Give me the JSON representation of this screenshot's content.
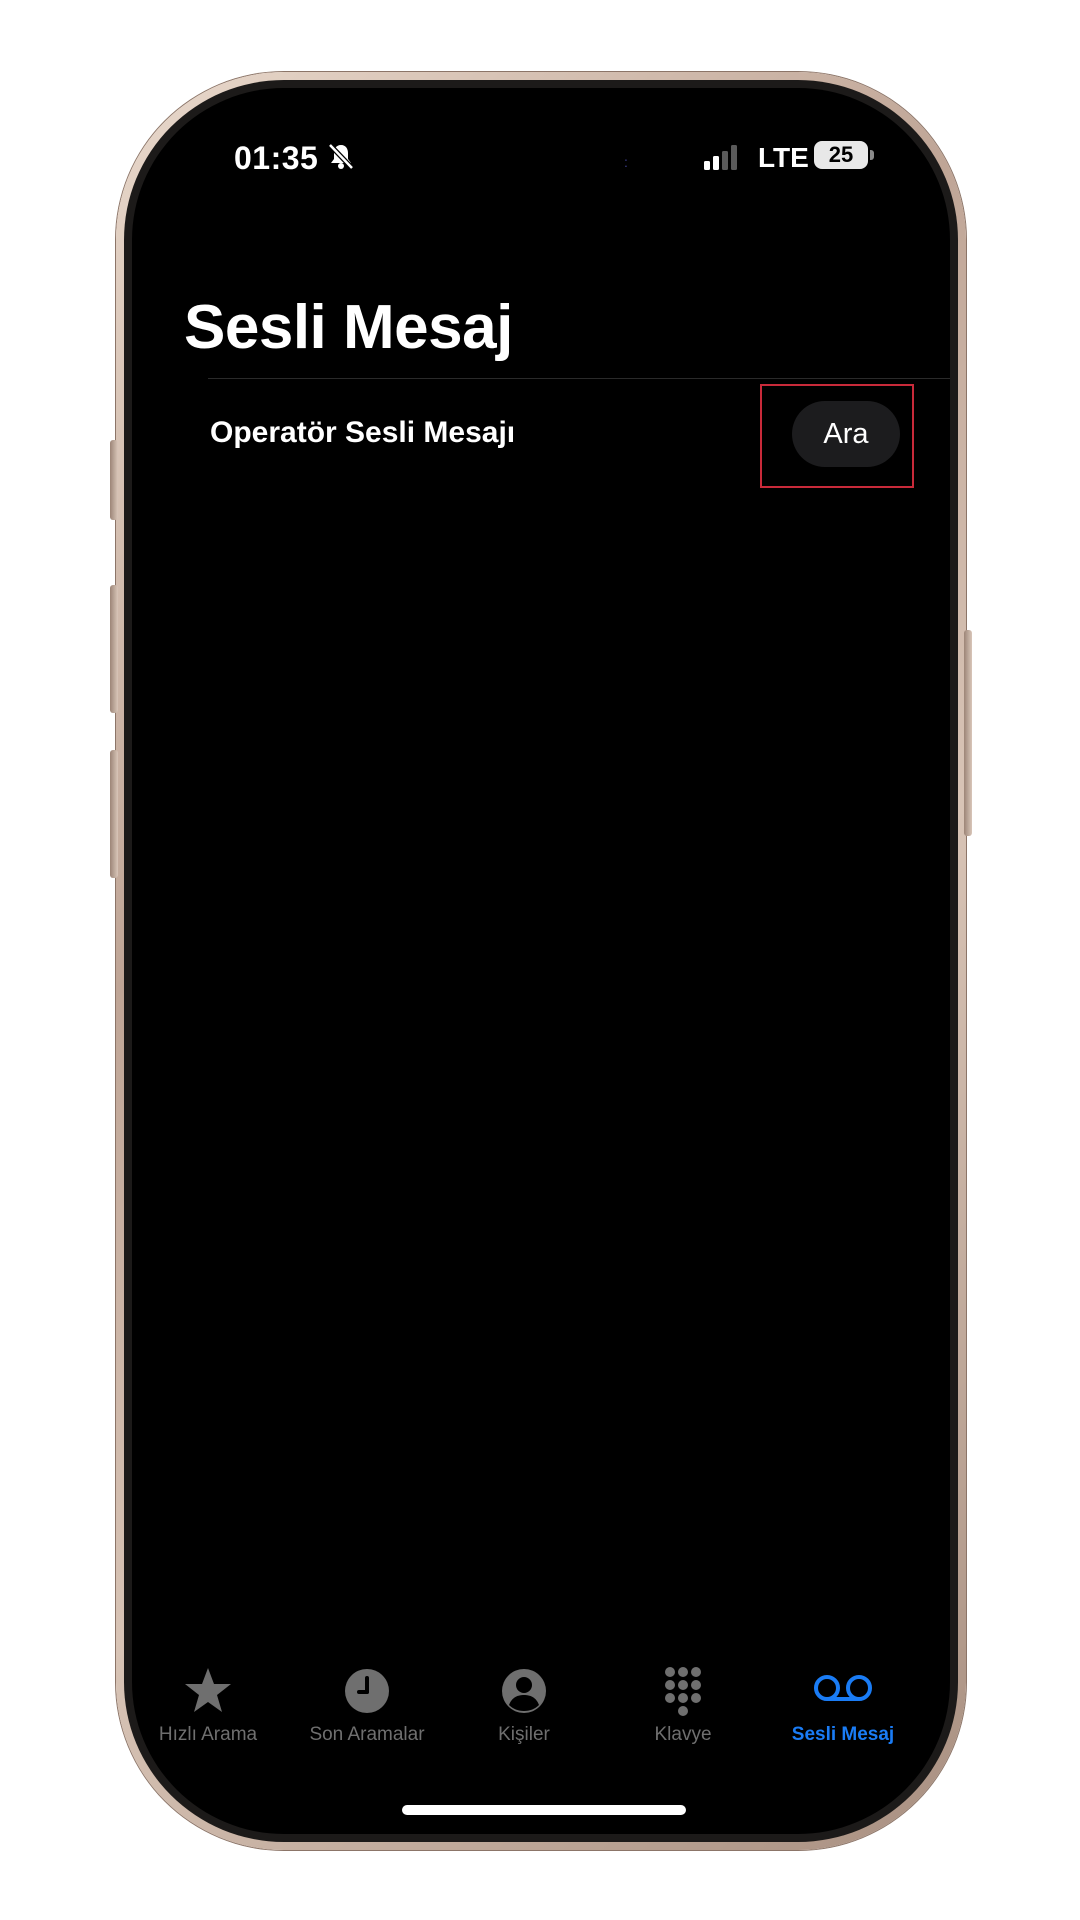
{
  "status_bar": {
    "time": "01:35",
    "network": "LTE",
    "battery_level": "25",
    "icons": [
      "bell-off-icon",
      "signal-icon"
    ]
  },
  "page": {
    "title": "Sesli Mesaj"
  },
  "voicemail_row": {
    "label": "Operatör Sesli Mesajı",
    "call_button_label": "Ara"
  },
  "tab_bar": {
    "active_color": "#1a7cf5",
    "inactive_color": "#6f6f6f",
    "tabs": [
      {
        "label": "Hızlı Arama",
        "icon": "star-icon"
      },
      {
        "label": "Son Aramalar",
        "icon": "clock-icon"
      },
      {
        "label": "Kişiler",
        "icon": "person-circle-icon"
      },
      {
        "label": "Klavye",
        "icon": "keypad-icon"
      },
      {
        "label": "Sesli Mesaj",
        "icon": "voicemail-icon",
        "active": true
      }
    ]
  },
  "annotation": {
    "highlight_color": "#c92a3a"
  }
}
